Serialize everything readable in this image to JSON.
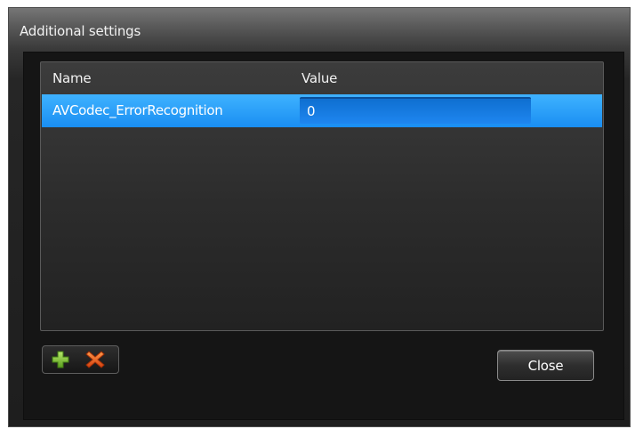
{
  "dialog": {
    "title": "Additional settings",
    "close_label": "Close"
  },
  "grid": {
    "columns": [
      "Name",
      "Value"
    ],
    "rows": [
      {
        "name": "AVCodec_ErrorRecognition",
        "value": "0",
        "selected": true
      }
    ]
  },
  "toolbar": {
    "add_icon": "plus-icon",
    "remove_icon": "x-icon"
  },
  "colors": {
    "selection": "#1a8ef2",
    "add_icon": "#7ec23a",
    "remove_icon": "#e8601c",
    "background": "#1e1e1e"
  }
}
